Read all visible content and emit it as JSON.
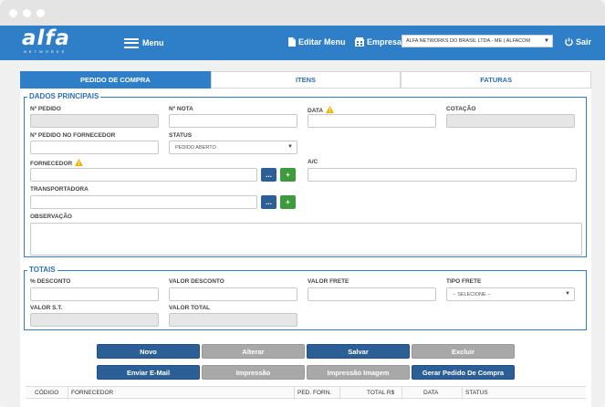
{
  "navbar": {
    "logo_text": "alfa",
    "logo_sub": "NETWORKS",
    "menu_label": "Menu",
    "edit_menu_label": "Editar Menu",
    "company_label": "Empresa",
    "company_value": "ALFA NETWORKS DO BRASIL LTDA - ME ( ALFACOM",
    "logout_label": "Sair"
  },
  "tabs": [
    {
      "label": "PEDIDO DE COMPRA",
      "active": true
    },
    {
      "label": "ITENS",
      "active": false
    },
    {
      "label": "FATURAS",
      "active": false
    }
  ],
  "principais": {
    "legend": "DADOS PRINCIPAIS",
    "num_pedido": "Nº PEDIDO",
    "num_nota": "Nº NOTA",
    "data": "DATA",
    "cotacao": "COTAÇÃO",
    "num_pedido_fornecedor": "Nº PEDIDO NO FORNECEDOR",
    "status": "STATUS",
    "status_value": "PEDIDO ABERTO",
    "fornecedor": "FORNECEDOR",
    "ac": "A/C",
    "transportadora": "TRANSPORTADORA",
    "observacao": "OBSERVAÇÃO",
    "search_button": "...",
    "add_button": "+"
  },
  "totais": {
    "legend": "TOTAIS",
    "desconto_pct": "% DESCONTO",
    "valor_desconto": "VALOR DESCONTO",
    "valor_frete": "VALOR FRETE",
    "tipo_frete": "TIPO FRETE",
    "tipo_frete_value": "-- SELECIONE --",
    "valor_st": "VALOR S.T.",
    "valor_total": "VALOR TOTAL"
  },
  "actions": {
    "novo": "Novo",
    "alterar": "Alterar",
    "salvar": "Salvar",
    "excluir": "Excluir",
    "enviar_email": "Enviar E-Mail",
    "impressao": "Impressão",
    "impressao_imagem": "Impressão Imagem",
    "gerar_pedido": "Gerar Pedido De Compra"
  },
  "grid": {
    "columns": [
      "CÓDIGO",
      "FORNECEDOR",
      "PED. FORN.",
      "TOTAL R$",
      "DATA",
      "STATUS"
    ]
  },
  "colors": {
    "brand": "#2f7fc8",
    "primary_button": "#2c5f95",
    "disabled_button": "#a8a8a8",
    "add_button": "#3d9a3d",
    "warning": "#f0b400"
  }
}
